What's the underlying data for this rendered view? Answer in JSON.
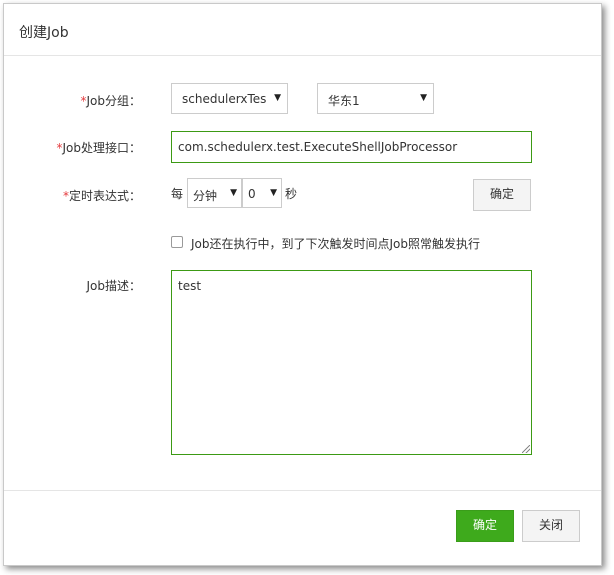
{
  "dialog": {
    "title": "创建Job"
  },
  "form": {
    "group": {
      "required_mark": "*",
      "label": "Job分组：",
      "group_value": "schedulerxTest",
      "region_value": "华东1"
    },
    "processor": {
      "required_mark": "*",
      "label": "Job处理接口：",
      "value": "com.schedulerx.test.ExecuteShellJobProcessor"
    },
    "cron": {
      "required_mark": "*",
      "label": "定时表达式：",
      "prefix": "每",
      "unit_value": "分钟",
      "second_value": "0",
      "suffix": "秒",
      "confirm_label": "确定"
    },
    "concurrent_checkbox": {
      "label": "Job还在执行中，到了下次触发时间点Job照常触发执行",
      "checked": false
    },
    "description": {
      "label": "Job描述：",
      "value": "test"
    }
  },
  "footer": {
    "ok_label": "确定",
    "close_label": "关闭"
  },
  "icons": {
    "dropdown": "chevron-down-icon",
    "resize": "resize-grip-icon"
  },
  "colors": {
    "accent_green": "#3eaa1c",
    "field_border_green": "#3c9a14",
    "required_red": "#e4393c"
  }
}
